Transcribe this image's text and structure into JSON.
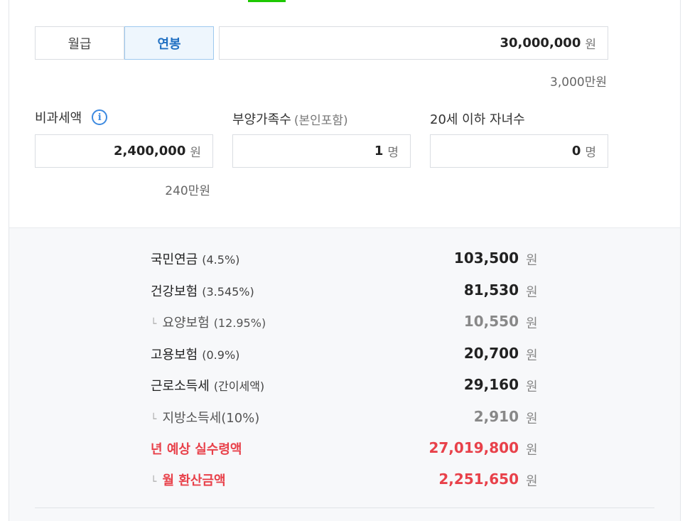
{
  "pay_type": {
    "tabs": [
      "월급",
      "연봉"
    ],
    "active_index": 1
  },
  "salary": {
    "value": "30,000,000",
    "unit": "원",
    "sub": "3,000만원"
  },
  "non_taxable": {
    "label": "비과세액",
    "value": "2,400,000",
    "unit": "원",
    "sub": "240만원"
  },
  "dependents": {
    "label": "부양가족수",
    "label_paren": "(본인포함)",
    "value": "1",
    "unit": "명"
  },
  "children": {
    "label": "20세 이하 자녀수",
    "value": "0",
    "unit": "명"
  },
  "results": [
    {
      "name": "국민연금",
      "pct": "(4.5%)",
      "amount": "103,500",
      "unit": "원",
      "kind": "normal"
    },
    {
      "name": "건강보험",
      "pct": "(3.545%)",
      "amount": "81,530",
      "unit": "원",
      "kind": "normal"
    },
    {
      "name": "요양보험",
      "pct": "(12.95%)",
      "amount": "10,550",
      "unit": "원",
      "kind": "sub"
    },
    {
      "name": "고용보험",
      "pct": "(0.9%)",
      "amount": "20,700",
      "unit": "원",
      "kind": "normal"
    },
    {
      "name": "근로소득세",
      "pct": "(간이세액)",
      "amount": "29,160",
      "unit": "원",
      "kind": "normal"
    },
    {
      "name": "지방소득세(10%)",
      "pct": "",
      "amount": "2,910",
      "unit": "원",
      "kind": "sub"
    },
    {
      "name": "년 예상 실수령액",
      "pct": "",
      "amount": "27,019,800",
      "unit": "원",
      "kind": "highlight"
    },
    {
      "name": "월 환산금액",
      "pct": "",
      "amount": "2,251,650",
      "unit": "원",
      "kind": "highlight-sub"
    }
  ],
  "colors": {
    "accent_blue": "#1f6fc2",
    "highlight_red": "#e8414a",
    "indicator_green": "#1ec800"
  }
}
